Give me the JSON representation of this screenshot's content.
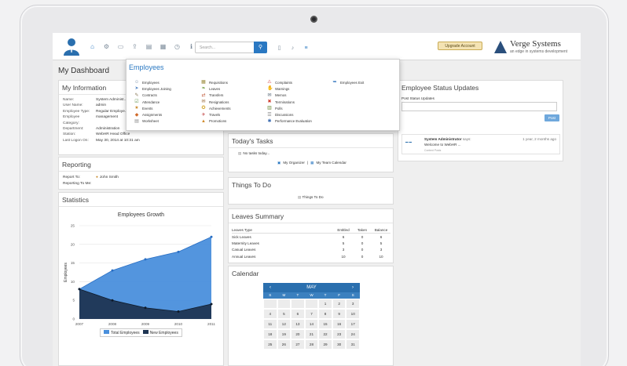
{
  "nav": {
    "search_placeholder": "Search...",
    "upgrade_label": "Upgrade Account",
    "brand_name": "Verge Systems",
    "brand_tagline": "an edge in systems development",
    "icons": [
      "home-icon",
      "org-icon",
      "id-card-icon",
      "upload-icon",
      "document-icon",
      "report-icon",
      "clock-icon",
      "info-icon"
    ],
    "right_icons": [
      "book-icon",
      "bell-icon",
      "menu-icon"
    ]
  },
  "page_title": "My Dashboard",
  "my_information": {
    "title": "My Information",
    "rows": [
      {
        "k": "Name:",
        "v": "System Administ..."
      },
      {
        "k": "User Name:",
        "v": "admin"
      },
      {
        "k": "Employee Type:",
        "v": "Regular Employe..."
      },
      {
        "k": "Employee Category:",
        "v": "management"
      },
      {
        "k": "Department:",
        "v": "Administration"
      },
      {
        "k": "Station:",
        "v": "WebHR Head Office"
      },
      {
        "k": "Last Logon On:",
        "v": "May 30, 2014 at 10:31 am"
      }
    ]
  },
  "reporting": {
    "title": "Reporting",
    "report_to_label": "Report To:",
    "report_to_value": "John Smith",
    "reporting_to_me_label": "Reporting To Me:"
  },
  "statistics": {
    "title": "Statistics",
    "chart_title": "Employees Growth"
  },
  "chart_data": {
    "type": "area",
    "title": "Employees Growth",
    "ylabel": "Employees",
    "x": [
      "2007",
      "2008",
      "2009",
      "2010",
      "2011"
    ],
    "ylim": [
      0,
      25
    ],
    "yticks": [
      "0",
      "5",
      "10",
      "15",
      "20",
      "25"
    ],
    "series": [
      {
        "name": "Total Employees",
        "color": "#4a8fdc",
        "values": [
          8,
          13,
          16,
          18,
          22
        ]
      },
      {
        "name": "New Employees",
        "color": "#1f3553",
        "values": [
          8,
          5,
          3,
          2,
          4
        ]
      }
    ],
    "legend": "bottom"
  },
  "employees_menu": {
    "title": "Employees",
    "columns": [
      [
        {
          "label": "Employees",
          "icon": "people-icon",
          "color": "#7a8fa6"
        },
        {
          "label": "Employees Joining",
          "icon": "join-icon",
          "color": "#5a8ac6"
        },
        {
          "label": "Contracts",
          "icon": "contract-icon",
          "color": "#8a7a5a"
        },
        {
          "label": "Attendance",
          "icon": "attendance-icon",
          "color": "#6a9a5a"
        },
        {
          "label": "Events",
          "icon": "events-icon",
          "color": "#c98a2a"
        },
        {
          "label": "Assignments",
          "icon": "assignments-icon",
          "color": "#d06a2a"
        },
        {
          "label": "Worksheet",
          "icon": "worksheet-icon",
          "color": "#8a8a8a"
        }
      ],
      [
        {
          "label": "Requisitions",
          "icon": "requisitions-icon",
          "color": "#9a8a3a"
        },
        {
          "label": "Leaves",
          "icon": "leaves-icon",
          "color": "#6a9a3a"
        },
        {
          "label": "Transfers",
          "icon": "transfers-icon",
          "color": "#c05a3a"
        },
        {
          "label": "Resignations",
          "icon": "resignations-icon",
          "color": "#9a6a3a"
        },
        {
          "label": "Achievements",
          "icon": "achievements-icon",
          "color": "#d0a020"
        },
        {
          "label": "Travels",
          "icon": "travels-icon",
          "color": "#c04040"
        },
        {
          "label": "Promotions",
          "icon": "promotions-icon",
          "color": "#d08a2a"
        }
      ],
      [
        {
          "label": "Complaints",
          "icon": "complaints-icon",
          "color": "#d04040"
        },
        {
          "label": "Warnings",
          "icon": "warnings-icon",
          "color": "#d09030"
        },
        {
          "label": "Memos",
          "icon": "memos-icon",
          "color": "#5a6a7a"
        },
        {
          "label": "Terminations",
          "icon": "terminations-icon",
          "color": "#d03a2a"
        },
        {
          "label": "Polls",
          "icon": "polls-icon",
          "color": "#6a8a3a"
        },
        {
          "label": "Discussions",
          "icon": "discussions-icon",
          "color": "#7a7a7a"
        },
        {
          "label": "Performance Evaluation",
          "icon": "performance-icon",
          "color": "#3a6ab0"
        }
      ],
      [
        {
          "label": "Employees Exit",
          "icon": "exit-icon",
          "color": "#3a7ac0"
        }
      ]
    ]
  },
  "todays_tasks": {
    "title": "Today's Tasks",
    "empty": "No tasks today...",
    "my_organizer": "My Organizer",
    "my_team_calendar": "My Team Calendar"
  },
  "things_to_do": {
    "title": "Things To Do",
    "link": "Things To Do"
  },
  "leaves_summary": {
    "title": "Leaves Summary",
    "headers": [
      "Leaves Type",
      "Entitled",
      "Taken",
      "Balance"
    ],
    "rows": [
      [
        "Sick Leaves",
        "6",
        "0",
        "6"
      ],
      [
        "Maternity Leaves",
        "5",
        "0",
        "5"
      ],
      [
        "Casual Leaves",
        "3",
        "0",
        "3"
      ],
      [
        "Annual Leaves",
        "10",
        "0",
        "10"
      ]
    ]
  },
  "calendar": {
    "title": "Calendar",
    "month": "MAY",
    "days": [
      "S",
      "M",
      "T",
      "W",
      "T",
      "F",
      "S"
    ],
    "weeks": [
      [
        "",
        "",
        "",
        "",
        "1",
        "2",
        "3"
      ],
      [
        "4",
        "5",
        "6",
        "7",
        "8",
        "9",
        "10"
      ],
      [
        "11",
        "12",
        "13",
        "14",
        "15",
        "16",
        "17"
      ],
      [
        "18",
        "19",
        "20",
        "21",
        "22",
        "23",
        "24"
      ],
      [
        "25",
        "26",
        "27",
        "28",
        "29",
        "30",
        "31"
      ]
    ]
  },
  "status_updates": {
    "title": "Employee Status Updates",
    "post_label": "Post Status Updates",
    "post_button": "Post",
    "update_author": "System Administrator",
    "update_says": "says:",
    "update_time": "1 year, 2 months ago",
    "update_text": "Welcome to WebHR ...",
    "update_meta": "Content Posts"
  }
}
